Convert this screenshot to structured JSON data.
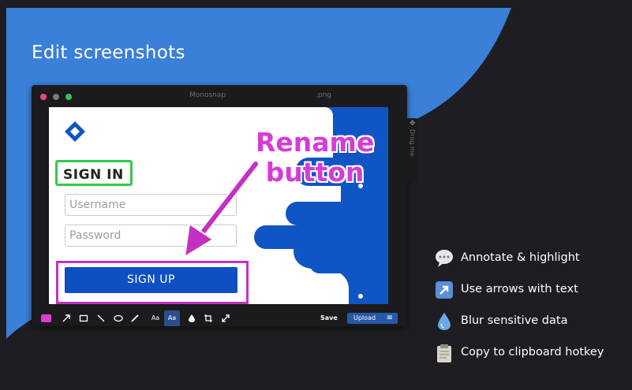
{
  "page": {
    "title": "Edit screenshots"
  },
  "app_window": {
    "title": "Monosnap",
    "file_ext": ".png",
    "side_handle_label": "Drag me",
    "canvas": {
      "heading": "SIGN IN",
      "username_placeholder": "Username",
      "password_placeholder": "Password",
      "signup_button": "SIGN UP",
      "annotation_text_line1": "Rename",
      "annotation_text_line2": "button"
    },
    "toolbar": {
      "text_size_label": "Aa",
      "text_style_label": "Aa",
      "save_label": "Save",
      "upload_label": "Upload",
      "selected_color": "#e03bd4"
    }
  },
  "features": [
    {
      "icon": "speech-bubble-icon",
      "label": "Annotate & highlight"
    },
    {
      "icon": "arrow-icon",
      "label": "Use arrows with text"
    },
    {
      "icon": "drop-icon",
      "label": "Blur sensitive data"
    },
    {
      "icon": "clipboard-icon",
      "label": "Copy to clipboard hotkey"
    }
  ],
  "colors": {
    "background": "#1e1e22",
    "brand_blue": "#3a7fd8",
    "annotation_magenta": "#d63bd8",
    "highlight_green": "#34c94b",
    "button_blue": "#0e4fc2"
  }
}
